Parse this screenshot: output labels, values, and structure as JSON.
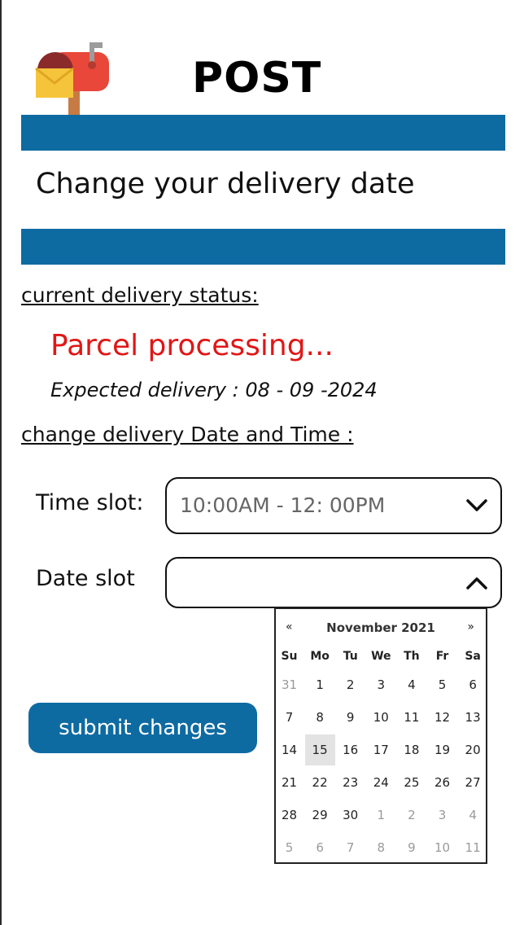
{
  "header": {
    "title": "POST"
  },
  "banner": {
    "title": "Change your delivery date"
  },
  "status": {
    "section_label": "current delivery status:",
    "state": "Parcel processing...",
    "expected": "Expected delivery : 08 - 09 -2024",
    "state_color": "#e11616"
  },
  "change": {
    "section_label": "change delivery Date and Time :",
    "time_label": "Time slot:",
    "time_value": "10:00AM - 12: 00PM",
    "date_label": "Date slot",
    "date_value": ""
  },
  "submit": {
    "label": "submit changes"
  },
  "calendar": {
    "prev": "«",
    "next": "»",
    "month": "November 2021",
    "weekdays": [
      "Su",
      "Mo",
      "Tu",
      "We",
      "Th",
      "Fr",
      "Sa"
    ],
    "weeks": [
      [
        "31",
        "1",
        "2",
        "3",
        "4",
        "5",
        "6"
      ],
      [
        "7",
        "8",
        "9",
        "10",
        "11",
        "12",
        "13"
      ],
      [
        "14",
        "15",
        "16",
        "17",
        "18",
        "19",
        "20"
      ],
      [
        "21",
        "22",
        "23",
        "24",
        "25",
        "26",
        "27"
      ],
      [
        "28",
        "29",
        "30",
        "1",
        "2",
        "3",
        "4"
      ],
      [
        "5",
        "6",
        "7",
        "8",
        "9",
        "10",
        "11"
      ]
    ],
    "selected_day": "15"
  },
  "colors": {
    "brand": "#0e6ba2",
    "alert": "#e11616"
  }
}
